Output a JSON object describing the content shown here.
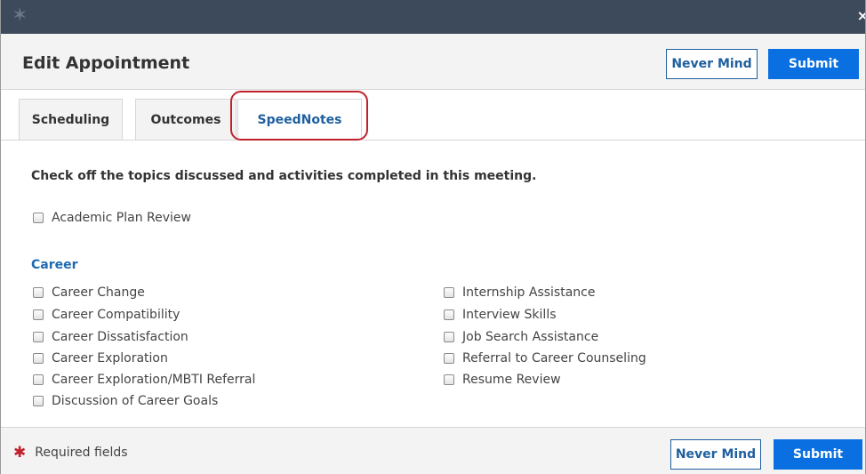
{
  "window": {
    "logo_icon": "star-logo-icon",
    "close_label": "×"
  },
  "header": {
    "title": "Edit Appointment",
    "never_mind_label": "Never Mind",
    "submit_label": "Submit"
  },
  "tabs": [
    {
      "label": "Scheduling",
      "active": false
    },
    {
      "label": "Outcomes",
      "active": false
    },
    {
      "label": "SpeedNotes",
      "active": true
    }
  ],
  "content": {
    "instruction": "Check off the topics discussed and activities completed in this meeting.",
    "general_items": [
      "Academic Plan Review"
    ],
    "career_section": {
      "heading": "Career",
      "left_items": [
        "Career Change",
        "Career Compatibility",
        "Career Dissatisfaction",
        "Career Exploration",
        "Career Exploration/MBTI Referral",
        "Discussion of Career Goals"
      ],
      "right_items": [
        "Internship Assistance",
        "Interview Skills",
        "Job Search Assistance",
        "Referral to Career Counseling",
        "Resume Review"
      ]
    }
  },
  "footer": {
    "required_star": "✱",
    "required_label": "Required fields",
    "never_mind_label": "Never Mind",
    "submit_label": "Submit"
  },
  "colors": {
    "topbar": "#3d4a5c",
    "primary": "#0a6fe0",
    "link": "#1f5f9e",
    "highlight": "#c0202a"
  }
}
